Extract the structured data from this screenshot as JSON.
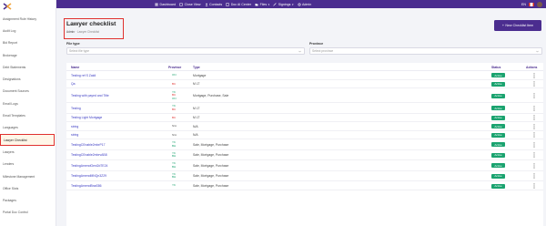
{
  "sidebar": {
    "items": [
      {
        "label": "Assignment Rule History"
      },
      {
        "label": "Audit Log"
      },
      {
        "label": "Bid Report"
      },
      {
        "label": "Brokerage"
      },
      {
        "label": "Debt Statements"
      },
      {
        "label": "Designations"
      },
      {
        "label": "Document Sources"
      },
      {
        "label": "Email Logs"
      },
      {
        "label": "Email Templates"
      },
      {
        "label": "Languages"
      },
      {
        "label": "Lawyer Checklist"
      },
      {
        "label": "Lawyers"
      },
      {
        "label": "Lenders"
      },
      {
        "label": "Milestone Management"
      },
      {
        "label": "Office Slots"
      },
      {
        "label": "Packages"
      },
      {
        "label": "Portal Doc Control"
      }
    ],
    "active_index": 10
  },
  "topbar": {
    "nav": [
      {
        "label": "Dashboard",
        "icon": "dashboard-icon"
      },
      {
        "label": "Close View",
        "icon": "close-view-icon"
      },
      {
        "label": "Contacts",
        "icon": "contacts-icon"
      },
      {
        "label": "Doc AI Center",
        "icon": "doc-ai-icon"
      },
      {
        "label": "Files",
        "icon": "files-icon"
      },
      {
        "label": "Signings",
        "icon": "signings-icon"
      },
      {
        "label": "Admin",
        "icon": "admin-icon"
      }
    ],
    "language": "EN"
  },
  "header": {
    "title": "Lawyer checklist",
    "breadcrumb_home": "Admin",
    "breadcrumb_sep": "·",
    "breadcrumb_current": "Lawyer Checklist",
    "new_button": "New Checklist Item"
  },
  "filters": {
    "file_type_label": "File type",
    "file_type_placeholder": "Select file type",
    "province_label": "Province",
    "province_placeholder": "Select province"
  },
  "table": {
    "columns": [
      "Name",
      "Province",
      "Type",
      "Status",
      "Actions"
    ],
    "rows": [
      {
        "name": "Testing ref S Zaidi",
        "provinces": [
          {
            "code": "ON",
            "color": "green"
          }
        ],
        "type": "Mortgage",
        "status": "Active"
      },
      {
        "name": "Qa",
        "provinces": [
          {
            "code": "BC",
            "color": "red"
          }
        ],
        "type": "M LT",
        "status": "Active"
      },
      {
        "name": "Testing with payed and Title",
        "provinces": [
          {
            "code": "YK",
            "color": "green"
          },
          {
            "code": "BC",
            "color": "red"
          },
          {
            "code": "ON",
            "color": "green"
          }
        ],
        "type": "Mortgage, Purchase, Sale",
        "status": "Active"
      },
      {
        "name": "Testing",
        "provinces": [
          {
            "code": "YK",
            "color": "green"
          },
          {
            "code": "BC",
            "color": "red"
          }
        ],
        "type": "M LT",
        "status": "Active"
      },
      {
        "name": "Testing Light Mortgage",
        "provinces": [
          {
            "code": "BC",
            "color": "red"
          }
        ],
        "type": "M LT",
        "status": "Active"
      },
      {
        "name": "string",
        "provinces": [
          {
            "code": "N/A",
            "color": "gray"
          }
        ],
        "type": "N/A",
        "status": "Active"
      },
      {
        "name": "string",
        "provinces": [
          {
            "code": "N/A",
            "color": "gray"
          }
        ],
        "type": "N/A",
        "status": "Active"
      },
      {
        "name": "TestingCEnable2mbrP17",
        "provinces": [
          {
            "code": "YK",
            "color": "green"
          },
          {
            "code": "BH",
            "color": "green"
          }
        ],
        "type": "Sale, Mortgage, Purchase",
        "status": "Active"
      },
      {
        "name": "TestingCEnable2mbrvAB8",
        "provinces": [
          {
            "code": "YK",
            "color": "green"
          },
          {
            "code": "BH",
            "color": "green"
          }
        ],
        "type": "Sale, Mortgage, Purchase",
        "status": "Active"
      },
      {
        "name": "TestingAmendGeni2d7E24",
        "provinces": [
          {
            "code": "YK",
            "color": "green"
          },
          {
            "code": "BH",
            "color": "green"
          }
        ],
        "type": "Sale, Mortgage, Purchase",
        "status": "Active"
      },
      {
        "name": "TestingAmendMNQn3Z29",
        "provinces": [
          {
            "code": "YK",
            "color": "green"
          },
          {
            "code": "BH",
            "color": "green"
          }
        ],
        "type": "Sale, Mortgage, Purchase",
        "status": "Active"
      },
      {
        "name": "TestingAmendBnaS86",
        "provinces": [
          {
            "code": "YK",
            "color": "green"
          }
        ],
        "type": "Sale, Mortgage, Purchase",
        "status": "Active"
      }
    ]
  },
  "colors": {
    "brand": "#4b2d8f",
    "active_status": "#1aa36f",
    "highlight_border": "#e0312f",
    "link": "#3d3dc4"
  }
}
